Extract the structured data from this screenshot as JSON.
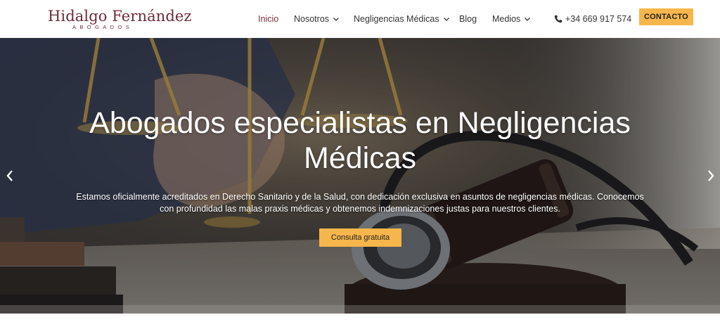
{
  "brand": {
    "name": "Hidalgo Fernández",
    "subtitle": "ABOGADOS"
  },
  "nav": {
    "items": [
      {
        "label": "Inicio",
        "active": true
      },
      {
        "label": "Nosotros",
        "has_dropdown": true
      },
      {
        "label": "Negligencias Médicas",
        "has_dropdown": true
      },
      {
        "label": "Blog"
      },
      {
        "label": "Medios",
        "has_dropdown": true
      }
    ],
    "phone": "+34 669 917 574",
    "cta": "CONTACTO"
  },
  "hero": {
    "title": "Abogados especialistas en Negligencias Médicas",
    "text": "Estamos oficialmente acreditados en Derecho Sanitario y de la Salud, con dedicación exclusiva en asuntos de negligencias médicas. Conocemos con profundidad las malas praxis médicas y obtenemos indemnizaciones justas para nuestros clientes.",
    "button": "Consulta gratuita",
    "prev_icon": "chevron-left-icon",
    "next_icon": "chevron-right-icon"
  },
  "colors": {
    "brand": "#6e2a3c",
    "accent": "#f7b64b",
    "active_nav": "#7a2c40"
  }
}
